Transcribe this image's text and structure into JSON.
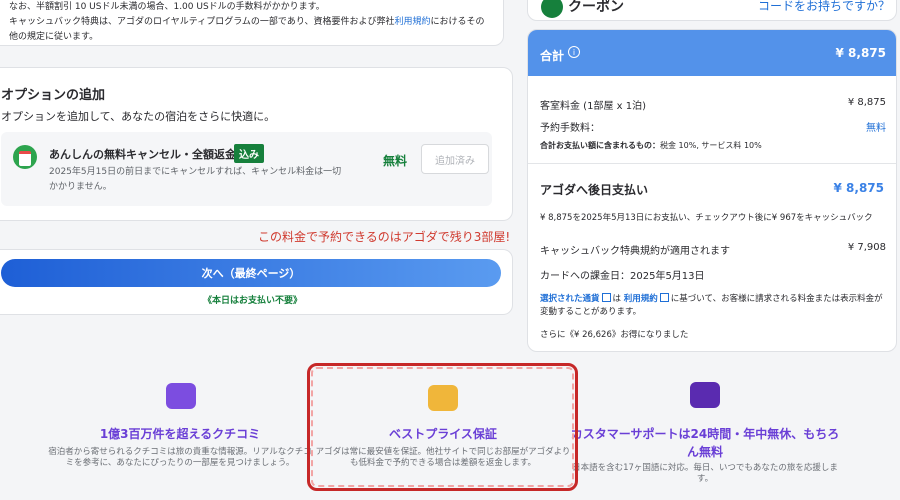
{
  "cashback": {
    "line1": "なお、半額割引 10 USドル未満の場合、1.00 USドルの手数料がかかります。",
    "line2_prefix": "キャッシュバック特典は、アゴダのロイヤルティプログラムの一部であり、資格要件および弊社",
    "line2_link": "利用規約",
    "line2_suffix": "におけるその",
    "line3": "他の規定に従います。"
  },
  "options": {
    "title": "オプションの追加",
    "description": "オプションを追加して、あなたの宿泊をさらに快適に。",
    "item": {
      "name": "あんしんの無料キャンセル・全額返金",
      "badge": "込み",
      "note": "2025年5月15日の前日までにキャンセルすれば、キャンセル料金は一切かかりません。",
      "price": "無料",
      "button": "追加済み"
    }
  },
  "scarcity": "この料金で予約できるのはアゴダで残り3部屋!",
  "next": {
    "button": "次へ（最終ページ）",
    "note": "《本日はお支払い不要》"
  },
  "coupon": {
    "label": "クーポン",
    "link": "コードをお持ちですか？"
  },
  "summary": {
    "title": "合計",
    "info": "i",
    "total": "¥ 8,875",
    "rows": [
      {
        "label": "客室料金 (1部屋 x 1泊)",
        "value": "¥ 8,875"
      },
      {
        "label": "予約手数料：",
        "value": "無料"
      }
    ],
    "tax_label": "合計お支払い額に含まれるもの：",
    "tax_value": "税金 10%, サービス料 10%",
    "pay_title": "アゴダへ後日支払い",
    "pay_amount": "¥ 8,875",
    "pay_note": "¥ 8,875を2025年5月13日にお支払い、チェックアウト後に¥ 967をキャッシュバック",
    "cashback_label": "キャッシュバック特典規約が適用されます",
    "cashback_value": "¥ 7,908",
    "charge_date": "カードへの課金日：2025年5月13日",
    "fx_currency": "選択された通貨",
    "fx_mid": "は",
    "fx_terms": "利用規約",
    "fx_rest": "に基づいて、お客様に請求される料金または表示料金が変動することがあります。",
    "savings": "さらに《¥ 26,626》お得になりました"
  },
  "features": [
    {
      "title": "1億3百万件を超えるクチコミ",
      "desc": "宿泊者から寄せられるクチコミは旅の貴重な情報源。リアルなクチコミを参考に、あなたにぴったりの一部屋を見つけましょう。",
      "icon": "chat-bubbles-icon"
    },
    {
      "title": "ベストプライス保証",
      "desc": "アゴダは常に最安値を保証。他社サイトで同じお部屋がアゴダよりも低料金で予約できる場合は差額を返金します。",
      "icon": "price-tags-icon"
    },
    {
      "title": "カスタマーサポートは24時間・年中無休、もちろん無料",
      "desc": "日本語を含む17ヶ国語に対応。毎日、いつでもあなたの旅を応援します。",
      "icon": "support-icon"
    }
  ],
  "colors": {
    "accent": "#5392ea",
    "green": "#16803c",
    "alert": "#d03a2f",
    "feature_title": "#6a3fd6"
  }
}
